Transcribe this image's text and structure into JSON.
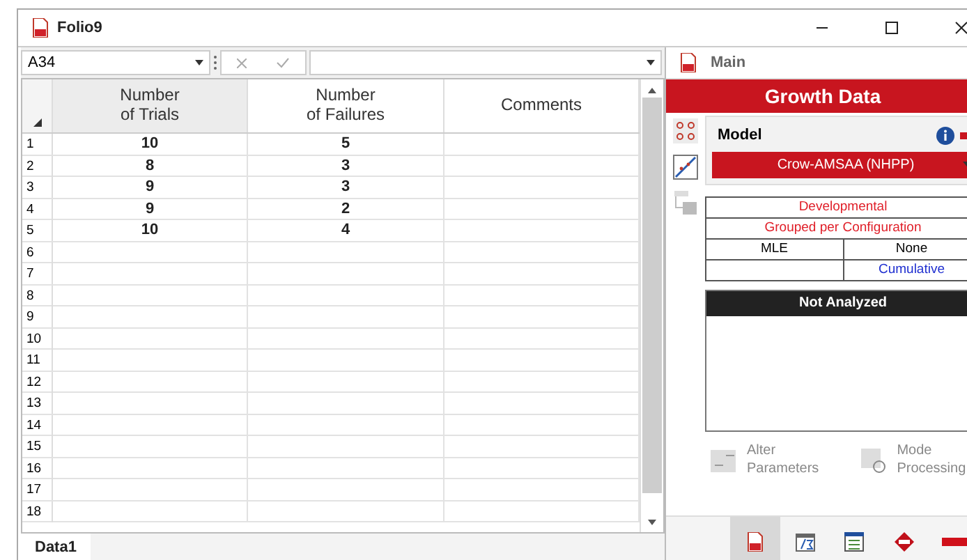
{
  "window": {
    "title": "Folio9"
  },
  "formula_bar": {
    "cell_ref": "A34"
  },
  "table": {
    "columns": [
      "Number\nof Trials",
      "Number\nof Failures",
      "Comments"
    ],
    "rows": [
      {
        "number": "1",
        "cells": [
          "10",
          "5"
        ]
      },
      {
        "number": "2",
        "cells": [
          "8",
          "3"
        ]
      },
      {
        "number": "3",
        "cells": [
          "9",
          "3"
        ]
      },
      {
        "number": "4",
        "cells": [
          "9",
          "2"
        ]
      },
      {
        "number": "5",
        "cells": [
          "10",
          "4"
        ]
      },
      {
        "number": "6"
      },
      {
        "number": "7"
      },
      {
        "number": "8"
      },
      {
        "number": "9"
      },
      {
        "number": "10"
      },
      {
        "number": "11"
      },
      {
        "number": "12"
      },
      {
        "number": "13"
      },
      {
        "number": "14"
      },
      {
        "number": "15"
      },
      {
        "number": "16"
      },
      {
        "number": "17"
      },
      {
        "number": "18"
      }
    ]
  },
  "sheet_tabs": [
    {
      "label": "Data1",
      "selected": true
    }
  ],
  "panel": {
    "title": "Main",
    "heading": "Growth Data",
    "model_label": "Model",
    "model": "Crow-AMSAA (NHPP)",
    "settings": {
      "data_type": "Developmental",
      "grouping": "Grouped per Configuration",
      "method": "MLE",
      "bounds": "None",
      "mode": "Cumulative"
    },
    "status": "Not Analyzed",
    "actions": [
      {
        "label": "Alter\nParameters",
        "kind": "alter"
      },
      {
        "label": "Mode\nProcessing",
        "kind": "mode"
      }
    ],
    "toolbar": [
      {
        "kind": "doc",
        "selected": true
      },
      {
        "kind": "formula",
        "selected": false
      },
      {
        "kind": "list",
        "selected": false
      },
      {
        "kind": "badge",
        "selected": false
      },
      {
        "kind": "bar",
        "selected": false
      }
    ]
  }
}
